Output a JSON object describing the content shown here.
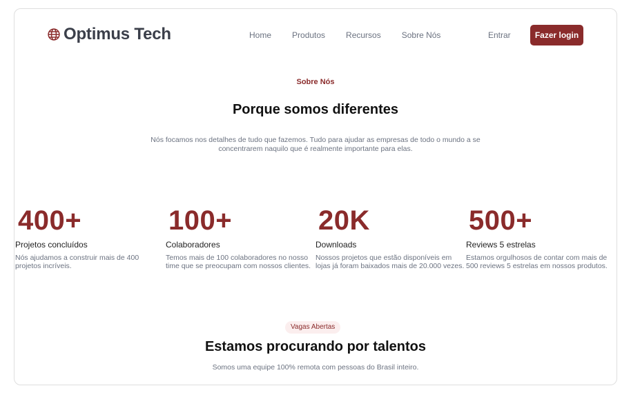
{
  "header": {
    "brand": "Optimus Tech",
    "brand_icon": "globe-icon",
    "nav": [
      "Home",
      "Produtos",
      "Recursos",
      "Sobre Nós"
    ],
    "entrar": "Entrar",
    "login": "Fazer login"
  },
  "about": {
    "eyebrow": "Sobre Nós",
    "title": "Porque somos diferentes",
    "description": "Nós focamos nos detalhes de tudo que fazemos. Tudo para ajudar as empresas de todo o mundo a se concentrarem naquilo que é realmente importante para elas."
  },
  "stats": [
    {
      "value": "400+",
      "label": "Projetos concluídos",
      "description": "Nós ajudamos a construir mais de 400 projetos incríveis."
    },
    {
      "value": "100+",
      "label": "Colaboradores",
      "description": "Temos mais de 100 colaboradores no nosso time que se preocupam com nossos clientes."
    },
    {
      "value": "20K",
      "label": "Downloads",
      "description": "Nossos projetos que estão disponíveis em lojas já foram baixados mais de 20.000 vezes."
    },
    {
      "value": "500+",
      "label": "Reviews 5 estrelas",
      "description": "Estamos orgulhosos de contar com mais de 500 reviews 5 estrelas em nossos produtos."
    }
  ],
  "careers": {
    "badge": "Vagas Abertas",
    "title": "Estamos procurando por talentos",
    "description": "Somos uma equipe 100% remota com pessoas do Brasil inteiro."
  },
  "colors": {
    "accent": "#8a2b2b",
    "text_dark": "#111111",
    "text_muted": "#6b7280",
    "badge_bg": "#fbeeee"
  }
}
